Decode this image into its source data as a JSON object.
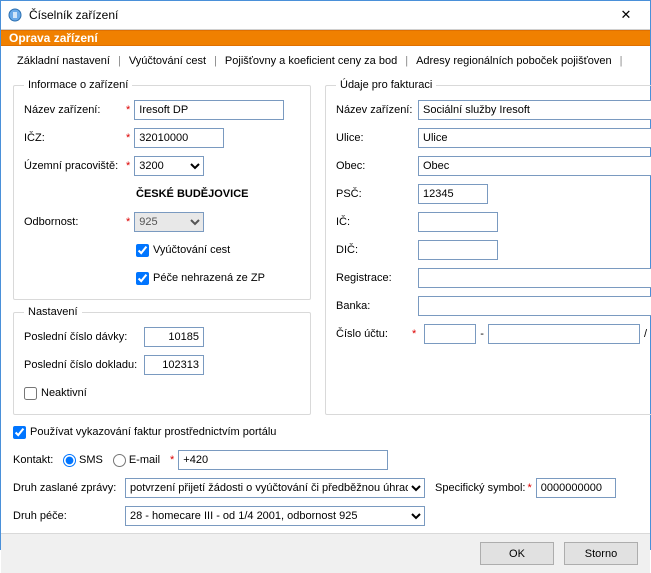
{
  "window": {
    "title": "Číselník zařízení",
    "close_glyph": "✕"
  },
  "banner": {
    "title": "Oprava zařízení"
  },
  "tabs": {
    "t0": "Základní nastavení",
    "t1": "Vyúčtování cest",
    "t2": "Pojišťovny a koeficient ceny za bod",
    "t3": "Adresy regionálních poboček pojišťoven"
  },
  "left": {
    "info_legend": "Informace o zařízení",
    "name_label": "Název zařízení:",
    "name_value": "Iresoft DP",
    "icz_label": "IČZ:",
    "icz_value": "32010000",
    "uzemni_label": "Územní pracoviště:",
    "uzemni_value": "3200",
    "uzemni_text": "ČESKÉ BUDĚJOVICE",
    "odbornost_label": "Odbornost:",
    "odbornost_value": "925",
    "chk_vyuctovani": "Vyúčtování cest",
    "chk_pece": "Péče nehrazená ze ZP",
    "settings_legend": "Nastavení",
    "posl_davky_label": "Poslední číslo dávky:",
    "posl_davky_value": "10185",
    "posl_dokladu_label": "Poslední číslo dokladu:",
    "posl_dokladu_value": "102313",
    "neaktivni_label": "Neaktivní"
  },
  "right": {
    "legend": "Údaje pro fakturaci",
    "name_label": "Název zařízení:",
    "name_value": "Sociální služby Iresoft",
    "ulice_label": "Ulice:",
    "ulice_value": "Ulice",
    "obec_label": "Obec:",
    "obec_value": "Obec",
    "psc_label": "PSČ:",
    "psc_value": "12345",
    "ic_label": "IČ:",
    "dic_label": "DIČ:",
    "registrace_label": "Registrace:",
    "banka_label": "Banka:",
    "ucet_label": "Číslo účtu:",
    "ucet_prefix": "",
    "ucet_main": "",
    "ucet_kod": ""
  },
  "portal": {
    "chk_label": "Používat vykazování faktur prostřednictvím portálu",
    "kontakt_label": "Kontakt:",
    "sms_label": "SMS",
    "email_label": "E-mail",
    "kontakt_value": "+420",
    "druh_zpravy_label": "Druh zaslané zprávy:",
    "druh_zpravy_value": "potvrzení přijetí žádosti o vyúčtování či předběžnou úhradu",
    "spec_symbol_label": "Specifický symbol:",
    "spec_symbol_value": "0000000000",
    "druh_pece_label": "Druh péče:",
    "druh_pece_value": "28 - homecare III - od 1/4 2001, odbornost 925"
  },
  "buttons": {
    "ok": "OK",
    "storno": "Storno"
  }
}
